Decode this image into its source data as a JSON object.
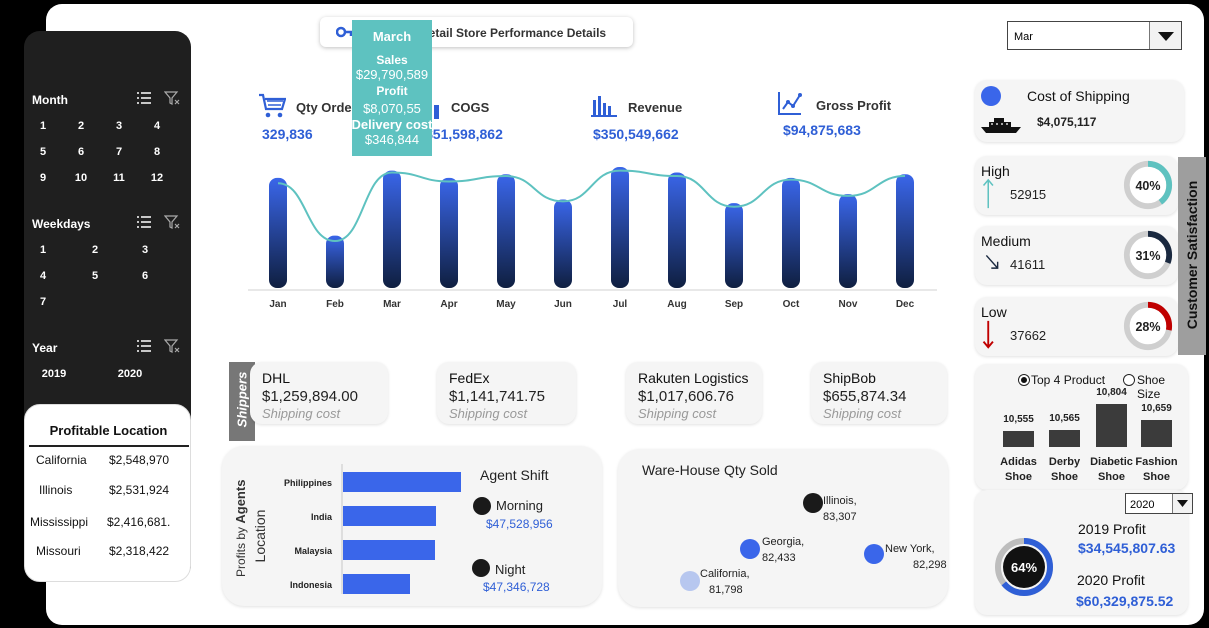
{
  "title": "Retail Store Performance Details",
  "month_selector": {
    "value": "Mar"
  },
  "slicers": {
    "month": {
      "label": "Month",
      "items": [
        "1",
        "2",
        "3",
        "4",
        "5",
        "6",
        "7",
        "8",
        "9",
        "10",
        "11",
        "12"
      ]
    },
    "weekdays": {
      "label": "Weekdays",
      "items": [
        "1",
        "2",
        "3",
        "4",
        "5",
        "6",
        "7"
      ]
    },
    "year": {
      "label": "Year",
      "items": [
        "2019",
        "2020"
      ]
    }
  },
  "profitable_location": {
    "title": "Profitable Location",
    "rows": [
      {
        "name": "California",
        "value": "$2,548,970"
      },
      {
        "name": "Illinois",
        "value": "$2,531,924"
      },
      {
        "name": "Mississippi",
        "value": "$2,416,681."
      },
      {
        "name": "Missouri",
        "value": "$2,318,422"
      }
    ]
  },
  "kpis": {
    "qty_order": {
      "label": "Qty Order",
      "value": "329,836"
    },
    "cogs": {
      "label": "COGS",
      "value": "$51,598,862"
    },
    "revenue": {
      "label": "Revenue",
      "value": "$350,549,662"
    },
    "gross_profit": {
      "label": "Gross Profit",
      "value": "$94,875,683"
    }
  },
  "tooltip": {
    "month": "March",
    "sales_label": "Sales",
    "sales_value": "$29,790,589",
    "profit_label": "Profit",
    "profit_value": "$8,070,55",
    "delivery_label": "Delivery cost",
    "delivery_value": "$346,844"
  },
  "chart_data": {
    "type": "bar",
    "categories": [
      "Jan",
      "Feb",
      "Mar",
      "Apr",
      "May",
      "Jun",
      "Jul",
      "Aug",
      "Sep",
      "Oct",
      "Nov",
      "Dec"
    ],
    "series": [
      {
        "values": [
          30.5,
          14.5,
          32.5,
          30.5,
          31.5,
          24.5,
          33.5,
          32.0,
          23.5,
          30.5,
          26.0,
          31.5
        ]
      },
      {
        "values": [
          29.0,
          13.0,
          32.0,
          29.5,
          31.0,
          24.0,
          32.5,
          31.0,
          22.5,
          30.0,
          25.5,
          31.0
        ]
      }
    ],
    "ylim": [
      0,
      36
    ],
    "colors": {
      "bar_top": "#3a66ea",
      "bar_bottom": "#0f1f40",
      "line": "#5ec2c0"
    }
  },
  "shippers": {
    "label": "Shippers",
    "caption": "Shipping cost",
    "items": [
      {
        "name": "DHL",
        "value": "$1,259,894.00"
      },
      {
        "name": "FedEx",
        "value": "$1,141,741.75"
      },
      {
        "name": "Rakuten Logistics",
        "value": "$1,017,606.76"
      },
      {
        "name": "ShipBob",
        "value": "$655,874.34"
      }
    ]
  },
  "agents": {
    "axis_label_1": "Profits by",
    "axis_label_2": "Agents",
    "axis_label_3": "Location",
    "bars": [
      {
        "name": "Philippines",
        "value": 118
      },
      {
        "name": "India",
        "value": 93
      },
      {
        "name": "Malaysia",
        "value": 92
      },
      {
        "name": "Indonesia",
        "value": 67
      }
    ],
    "shift_title": "Agent Shift",
    "morning_label": "Morning",
    "morning_value": "$47,528,956",
    "night_label": "Night",
    "night_value": "$47,346,728"
  },
  "warehouse": {
    "title": "Ware-House Qty Sold",
    "points": [
      {
        "name": "Illinois,",
        "value": "83,307",
        "color": "#1a1a1a"
      },
      {
        "name": "Georgia,",
        "value": "82,433",
        "color": "#3a66ea"
      },
      {
        "name": "New York,",
        "value": "82,298",
        "color": "#3a66ea"
      },
      {
        "name": "California,",
        "value": "81,798",
        "color": "#b7c7ef"
      }
    ]
  },
  "cost_of_shipping": {
    "label": "Cost of Shipping",
    "value": "$4,075,117"
  },
  "satisfaction": {
    "title": "Customer Satisfaction",
    "items": [
      {
        "label": "High",
        "value": "52915",
        "pct": 40,
        "pct_label": "40%",
        "color": "#5ec2c0"
      },
      {
        "label": "Medium",
        "value": "41611",
        "pct": 31,
        "pct_label": "31%",
        "color": "#1a2940"
      },
      {
        "label": "Low",
        "value": "37662",
        "pct": 28,
        "pct_label": "28%",
        "color": "#c00000"
      }
    ]
  },
  "top_products": {
    "option_1": "Top 4 Product",
    "option_2": "Shoe Size",
    "items": [
      {
        "name1": "Adidas",
        "name2": "Shoe",
        "value": 10555,
        "label": "10,555"
      },
      {
        "name1": "Derby",
        "name2": "Shoe",
        "value": 10565,
        "label": "10,565"
      },
      {
        "name1": "Diabetic",
        "name2": "Shoe",
        "value": 10804,
        "label": "10,804"
      },
      {
        "name1": "Fashion",
        "name2": "Shoe",
        "value": 10659,
        "label": "10,659"
      }
    ]
  },
  "profit_compare": {
    "year_selector": "2020",
    "donut_pct": 64,
    "donut_label": "64%",
    "p2019_label": "2019 Profit",
    "p2019_value": "$34,545,807.63",
    "p2020_label": "2020 Profit",
    "p2020_value": "$60,329,875.52"
  }
}
